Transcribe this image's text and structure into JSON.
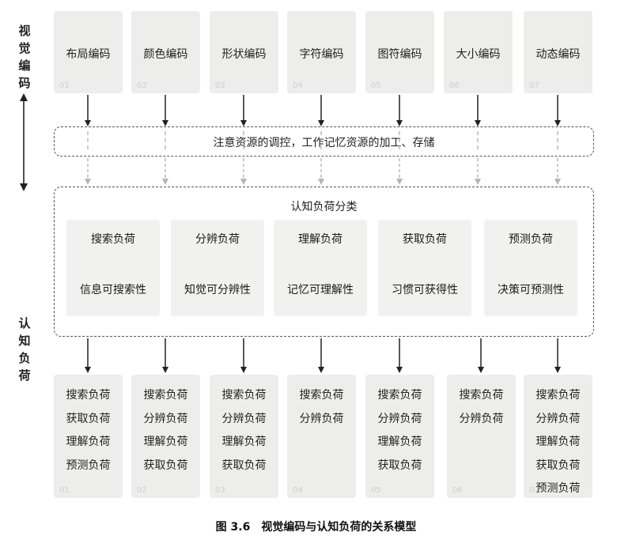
{
  "side_labels": {
    "visual_encoding": "视觉编码",
    "cognitive_load": "认知负荷"
  },
  "top_boxes": [
    {
      "label": "布局编码",
      "num": "01"
    },
    {
      "label": "颜色编码",
      "num": "02"
    },
    {
      "label": "形状编码",
      "num": "03"
    },
    {
      "label": "字符编码",
      "num": "04"
    },
    {
      "label": "图符编码",
      "num": "05"
    },
    {
      "label": "大小编码",
      "num": "06"
    },
    {
      "label": "动态编码",
      "num": "07"
    }
  ],
  "resource_note": "注意资源的调控，工作记忆资源的加工、存储",
  "classification": {
    "title": "认知负荷分类",
    "categories": [
      {
        "name": "搜索负荷",
        "desc": "信息可搜索性"
      },
      {
        "name": "分辨负荷",
        "desc": "知觉可分辨性"
      },
      {
        "name": "理解负荷",
        "desc": "记忆可理解性"
      },
      {
        "name": "获取负荷",
        "desc": "习惯可获得性"
      },
      {
        "name": "预测负荷",
        "desc": "决策可预测性"
      }
    ]
  },
  "bottom_boxes": [
    {
      "num": "01",
      "items": [
        "搜索负荷",
        "获取负荷",
        "理解负荷",
        "预测负荷"
      ]
    },
    {
      "num": "02",
      "items": [
        "搜索负荷",
        "分辨负荷",
        "理解负荷",
        "获取负荷"
      ]
    },
    {
      "num": "03",
      "items": [
        "搜索负荷",
        "分辨负荷",
        "理解负荷",
        "获取负荷"
      ]
    },
    {
      "num": "04",
      "items": [
        "搜索负荷",
        "分辨负荷"
      ]
    },
    {
      "num": "05",
      "items": [
        "搜索负荷",
        "分辨负荷",
        "理解负荷",
        "获取负荷"
      ]
    },
    {
      "num": "06",
      "items": [
        "搜索负荷",
        "分辨负荷"
      ]
    },
    {
      "num": "07",
      "items": [
        "搜索负荷",
        "分辨负荷",
        "理解负荷",
        "获取负荷",
        "预测负荷"
      ]
    }
  ],
  "caption": "图 3.6　视觉编码与认知负荷的关系模型"
}
